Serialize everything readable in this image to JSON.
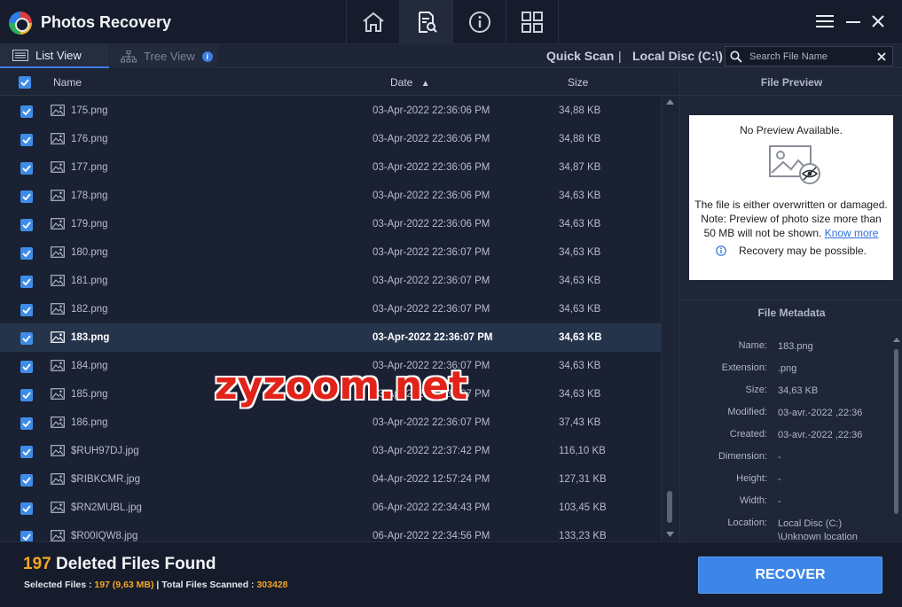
{
  "app": {
    "title": "Photos Recovery"
  },
  "top_tabs": [
    {
      "icon": "home-icon"
    },
    {
      "icon": "scan-results-icon"
    },
    {
      "icon": "info-icon"
    },
    {
      "icon": "grid-icon"
    }
  ],
  "view_tabs": {
    "list_view": "List View",
    "tree_view": "Tree View"
  },
  "scan": {
    "mode": "Quick Scan",
    "separator": "|",
    "location": "Local Disc (C:\\)"
  },
  "search": {
    "placeholder": "Search File Name"
  },
  "columns": {
    "name": "Name",
    "date": "Date",
    "size": "Size",
    "sort_indicator": "▲"
  },
  "files": [
    {
      "name": "175.png",
      "date": "03-Apr-2022 22:36:06 PM",
      "size": "34,88 KB"
    },
    {
      "name": "176.png",
      "date": "03-Apr-2022 22:36:06 PM",
      "size": "34,88 KB"
    },
    {
      "name": "177.png",
      "date": "03-Apr-2022 22:36:06 PM",
      "size": "34,87 KB"
    },
    {
      "name": "178.png",
      "date": "03-Apr-2022 22:36:06 PM",
      "size": "34,63 KB"
    },
    {
      "name": "179.png",
      "date": "03-Apr-2022 22:36:06 PM",
      "size": "34,63 KB"
    },
    {
      "name": "180.png",
      "date": "03-Apr-2022 22:36:07 PM",
      "size": "34,63 KB"
    },
    {
      "name": "181.png",
      "date": "03-Apr-2022 22:36:07 PM",
      "size": "34,63 KB"
    },
    {
      "name": "182.png",
      "date": "03-Apr-2022 22:36:07 PM",
      "size": "34,63 KB"
    },
    {
      "name": "183.png",
      "date": "03-Apr-2022 22:36:07 PM",
      "size": "34,63 KB",
      "selected": true
    },
    {
      "name": "184.png",
      "date": "03-Apr-2022 22:36:07 PM",
      "size": "34,63 KB"
    },
    {
      "name": "185.png",
      "date": "03-Apr-2022 22:36:07 PM",
      "size": "34,63 KB"
    },
    {
      "name": "186.png",
      "date": "03-Apr-2022 22:36:07 PM",
      "size": "37,43 KB"
    },
    {
      "name": "$RUH97DJ.jpg",
      "date": "03-Apr-2022 22:37:42 PM",
      "size": "116,10 KB"
    },
    {
      "name": "$RIBKCMR.jpg",
      "date": "04-Apr-2022 12:57:24 PM",
      "size": "127,31 KB"
    },
    {
      "name": "$RN2MUBL.jpg",
      "date": "06-Apr-2022 22:34:43 PM",
      "size": "103,45 KB"
    },
    {
      "name": "$R00IQW8.jpg",
      "date": "06-Apr-2022 22:34:56 PM",
      "size": "133,23 KB"
    }
  ],
  "preview": {
    "header": "File Preview",
    "title": "No Preview Available.",
    "message_1": "The file is either overwritten or damaged.",
    "message_2": "Note: Preview of photo size more than 50 MB will not be shown.",
    "know_more": "Know more",
    "recovery": "Recovery may be possible."
  },
  "metadata": {
    "header": "File Metadata",
    "rows": [
      {
        "key": "Name:",
        "value": "183.png"
      },
      {
        "key": "Extension:",
        "value": ".png"
      },
      {
        "key": "Size:",
        "value": "34,63 KB"
      },
      {
        "key": "Modified:",
        "value": "03-avr.-2022 ,22:36"
      },
      {
        "key": "Created:",
        "value": "03-avr.-2022 ,22:36"
      },
      {
        "key": "Dimension:",
        "value": "-"
      },
      {
        "key": "Height:",
        "value": "-"
      },
      {
        "key": "Width:",
        "value": "-"
      },
      {
        "key": "Location:",
        "value": "Local Disc (C:) \\Unknown location"
      }
    ]
  },
  "footer": {
    "count": "197",
    "found_label": "Deleted Files Found",
    "selected_label": "Selected Files :",
    "selected_value": "197 (9,63 MB)",
    "divider": "|",
    "total_label": "Total Files Scanned :",
    "total_value": "303428",
    "recover_button": "RECOVER"
  },
  "watermark": "zyzoom.net",
  "colors": {
    "accent": "#3d86e8",
    "highlight": "#f5a623",
    "background": "#1a2132"
  }
}
